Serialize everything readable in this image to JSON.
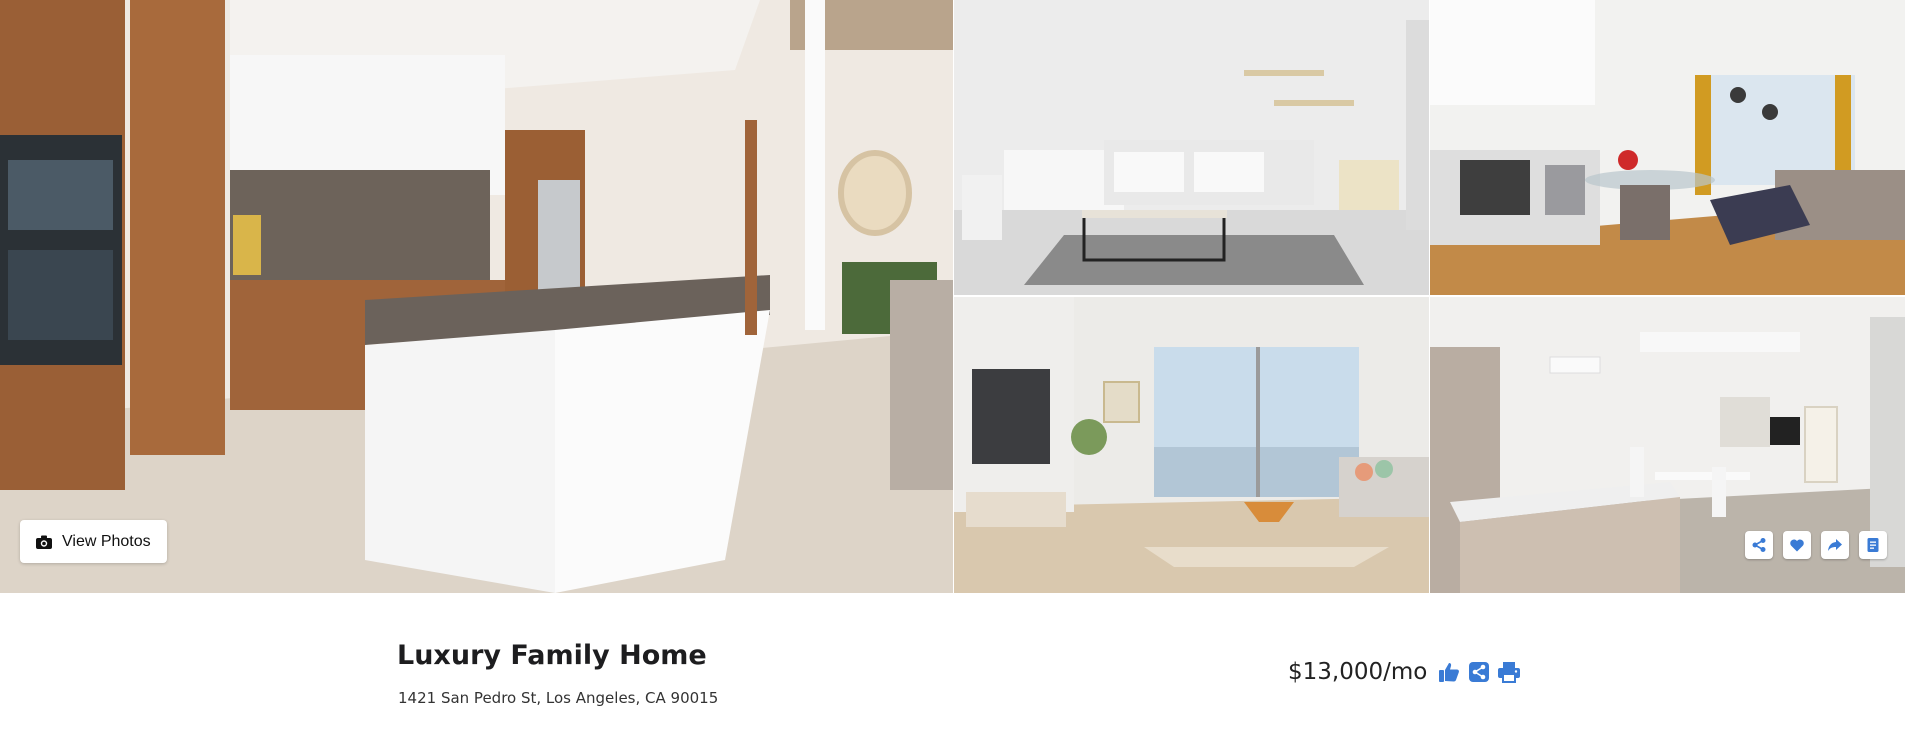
{
  "gallery": {
    "view_photos_label": "View Photos",
    "icons": {
      "camera": "camera-icon",
      "share": "share-icon",
      "favorite": "heart-icon",
      "forward": "forward-icon",
      "notes": "document-icon"
    }
  },
  "listing": {
    "title": "Luxury Family Home",
    "address": "1421 San Pedro St, Los Angeles, CA 90015",
    "price": "$13,000/mo",
    "price_icons": [
      "thumbs-up-icon",
      "share-square-icon",
      "print-icon"
    ]
  },
  "colors": {
    "accent": "#3a7bd5",
    "text_dark": "#1d1d1f",
    "background": "#ffffff"
  }
}
